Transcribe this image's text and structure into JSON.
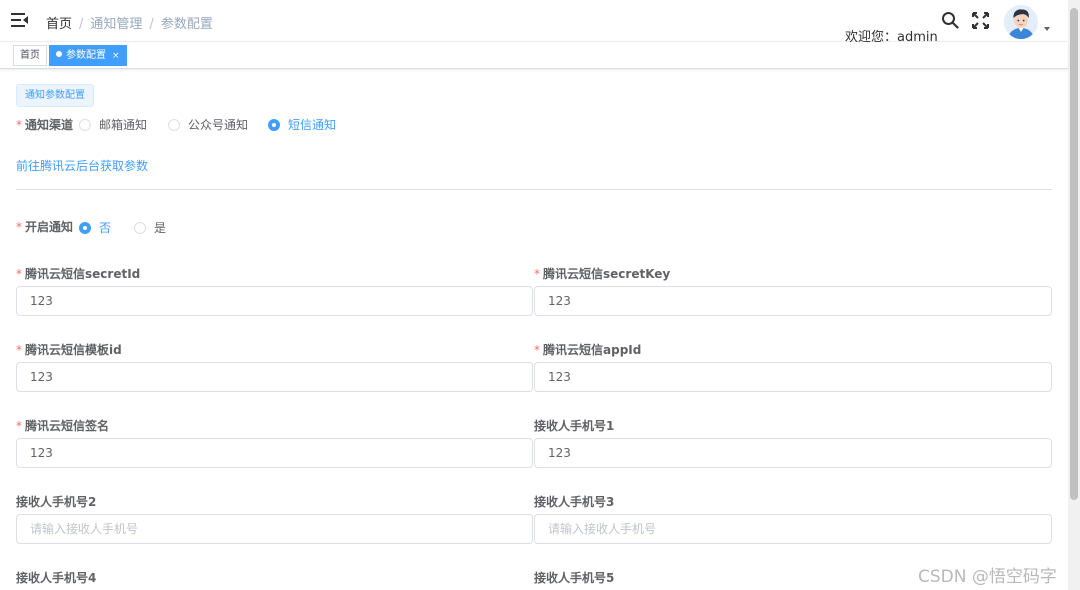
{
  "header": {
    "breadcrumb": [
      "首页",
      "通知管理",
      "参数配置"
    ],
    "separator": "/",
    "welcome": "欢迎您：admin"
  },
  "tags": {
    "home": "首页",
    "active": "参数配置",
    "close": "×"
  },
  "section": {
    "tag": "通知参数配置"
  },
  "channel": {
    "label": "通知渠道",
    "options": [
      "邮箱通知",
      "公众号通知",
      "短信通知"
    ],
    "selected": "短信通知"
  },
  "link": "前往腾讯云后台获取参数",
  "enable": {
    "label": "开启通知",
    "options": [
      "否",
      "是"
    ],
    "selected": "否"
  },
  "fields": {
    "secretId": {
      "label": "腾讯云短信secretId",
      "value": "123"
    },
    "secretKey": {
      "label": "腾讯云短信secretKey",
      "value": "123"
    },
    "templateId": {
      "label": "腾讯云短信模板id",
      "value": "123"
    },
    "appId": {
      "label": "腾讯云短信appId",
      "value": "123"
    },
    "signName": {
      "label": "腾讯云短信签名",
      "value": "123"
    },
    "phone1": {
      "label": "接收人手机号1",
      "value": "123"
    },
    "phone2": {
      "label": "接收人手机号2",
      "placeholder": "请输入接收人手机号"
    },
    "phone3": {
      "label": "接收人手机号3",
      "placeholder": "请输入接收人手机号"
    },
    "phone4": {
      "label": "接收人手机号4"
    },
    "phone5": {
      "label": "接收人手机号5"
    }
  },
  "watermark": "CSDN @悟空码字",
  "colors": {
    "primary": "#409eff",
    "required": "#f56c6c"
  }
}
